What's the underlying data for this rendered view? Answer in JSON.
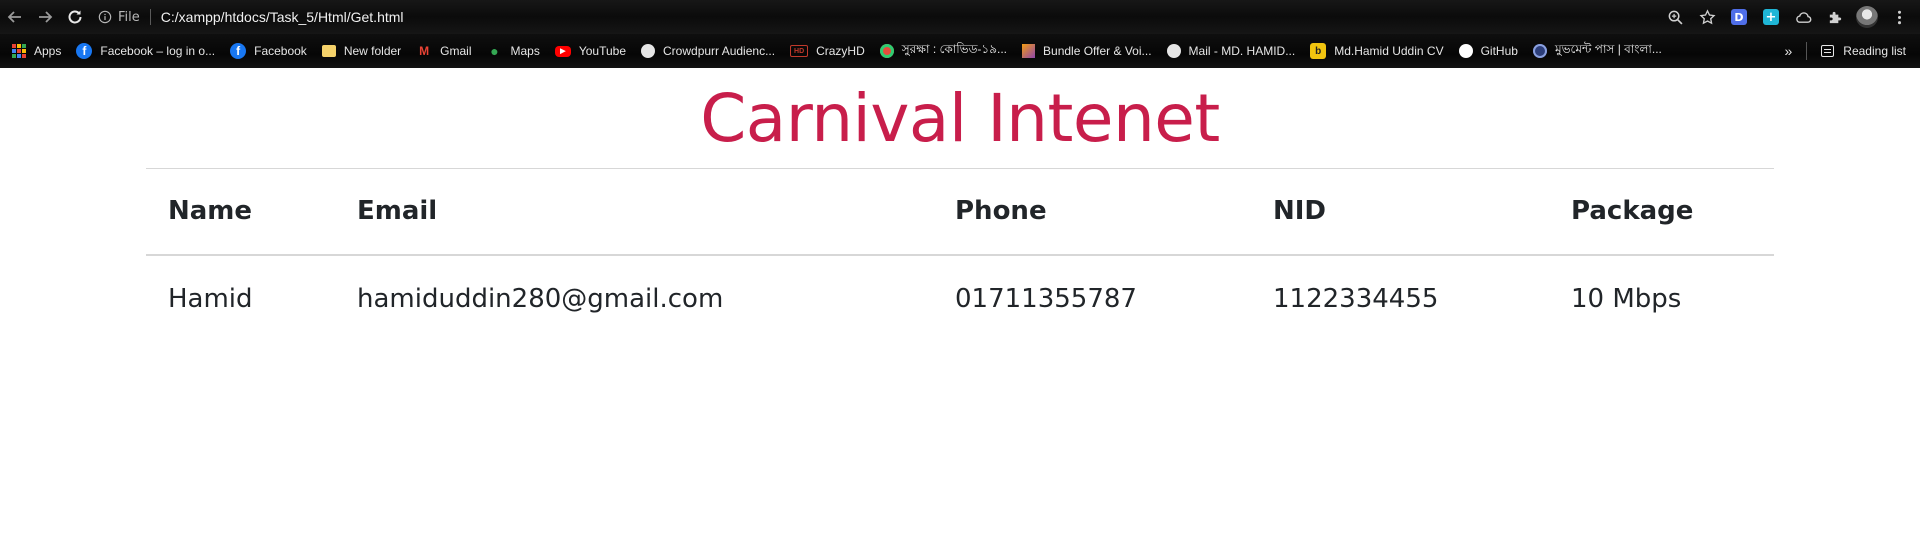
{
  "browser": {
    "info_label": "File",
    "url": "C:/xampp/htdocs/Task_5/Html/Get.html",
    "extensions": {
      "d_label": "D",
      "plus_label": "+"
    },
    "bookmarks": [
      {
        "label": "Apps",
        "icon": "apps-grid-icon"
      },
      {
        "label": "Facebook – log in o...",
        "icon": "facebook-icon"
      },
      {
        "label": "Facebook",
        "icon": "facebook-icon"
      },
      {
        "label": "New folder",
        "icon": "folder-icon"
      },
      {
        "label": "Gmail",
        "icon": "gmail-icon"
      },
      {
        "label": "Maps",
        "icon": "maps-icon"
      },
      {
        "label": "YouTube",
        "icon": "youtube-icon"
      },
      {
        "label": "Crowdpurr Audienc...",
        "icon": "globe-icon"
      },
      {
        "label": "CrazyHD",
        "icon": "hd-icon"
      },
      {
        "label": "সুরক্ষা : কোভিড-১৯...",
        "icon": "surokkha-icon"
      },
      {
        "label": "Bundle Offer & Voi...",
        "icon": "bundle-icon"
      },
      {
        "label": "Mail - MD. HAMID...",
        "icon": "globe-icon"
      },
      {
        "label": "Md.Hamid Uddin CV",
        "icon": "cv-icon"
      },
      {
        "label": "GitHub",
        "icon": "github-icon"
      },
      {
        "label": "মুভমেন্ট পাস | বাংলা...",
        "icon": "bd-police-icon"
      }
    ],
    "more_label": "»",
    "reading_list_label": "Reading list"
  },
  "page": {
    "title": "Carnival Intenet",
    "table": {
      "headers": [
        "Name",
        "Email",
        "Phone",
        "NID",
        "Package"
      ],
      "rows": [
        [
          "Hamid",
          "hamiduddin280@gmail.com",
          "01711355787",
          "1122334455",
          "10 Mbps"
        ]
      ]
    }
  },
  "colors": {
    "title": "#c81e4b",
    "text": "#212529",
    "chrome_bg": "#111111",
    "border": "#d7d7d7"
  }
}
